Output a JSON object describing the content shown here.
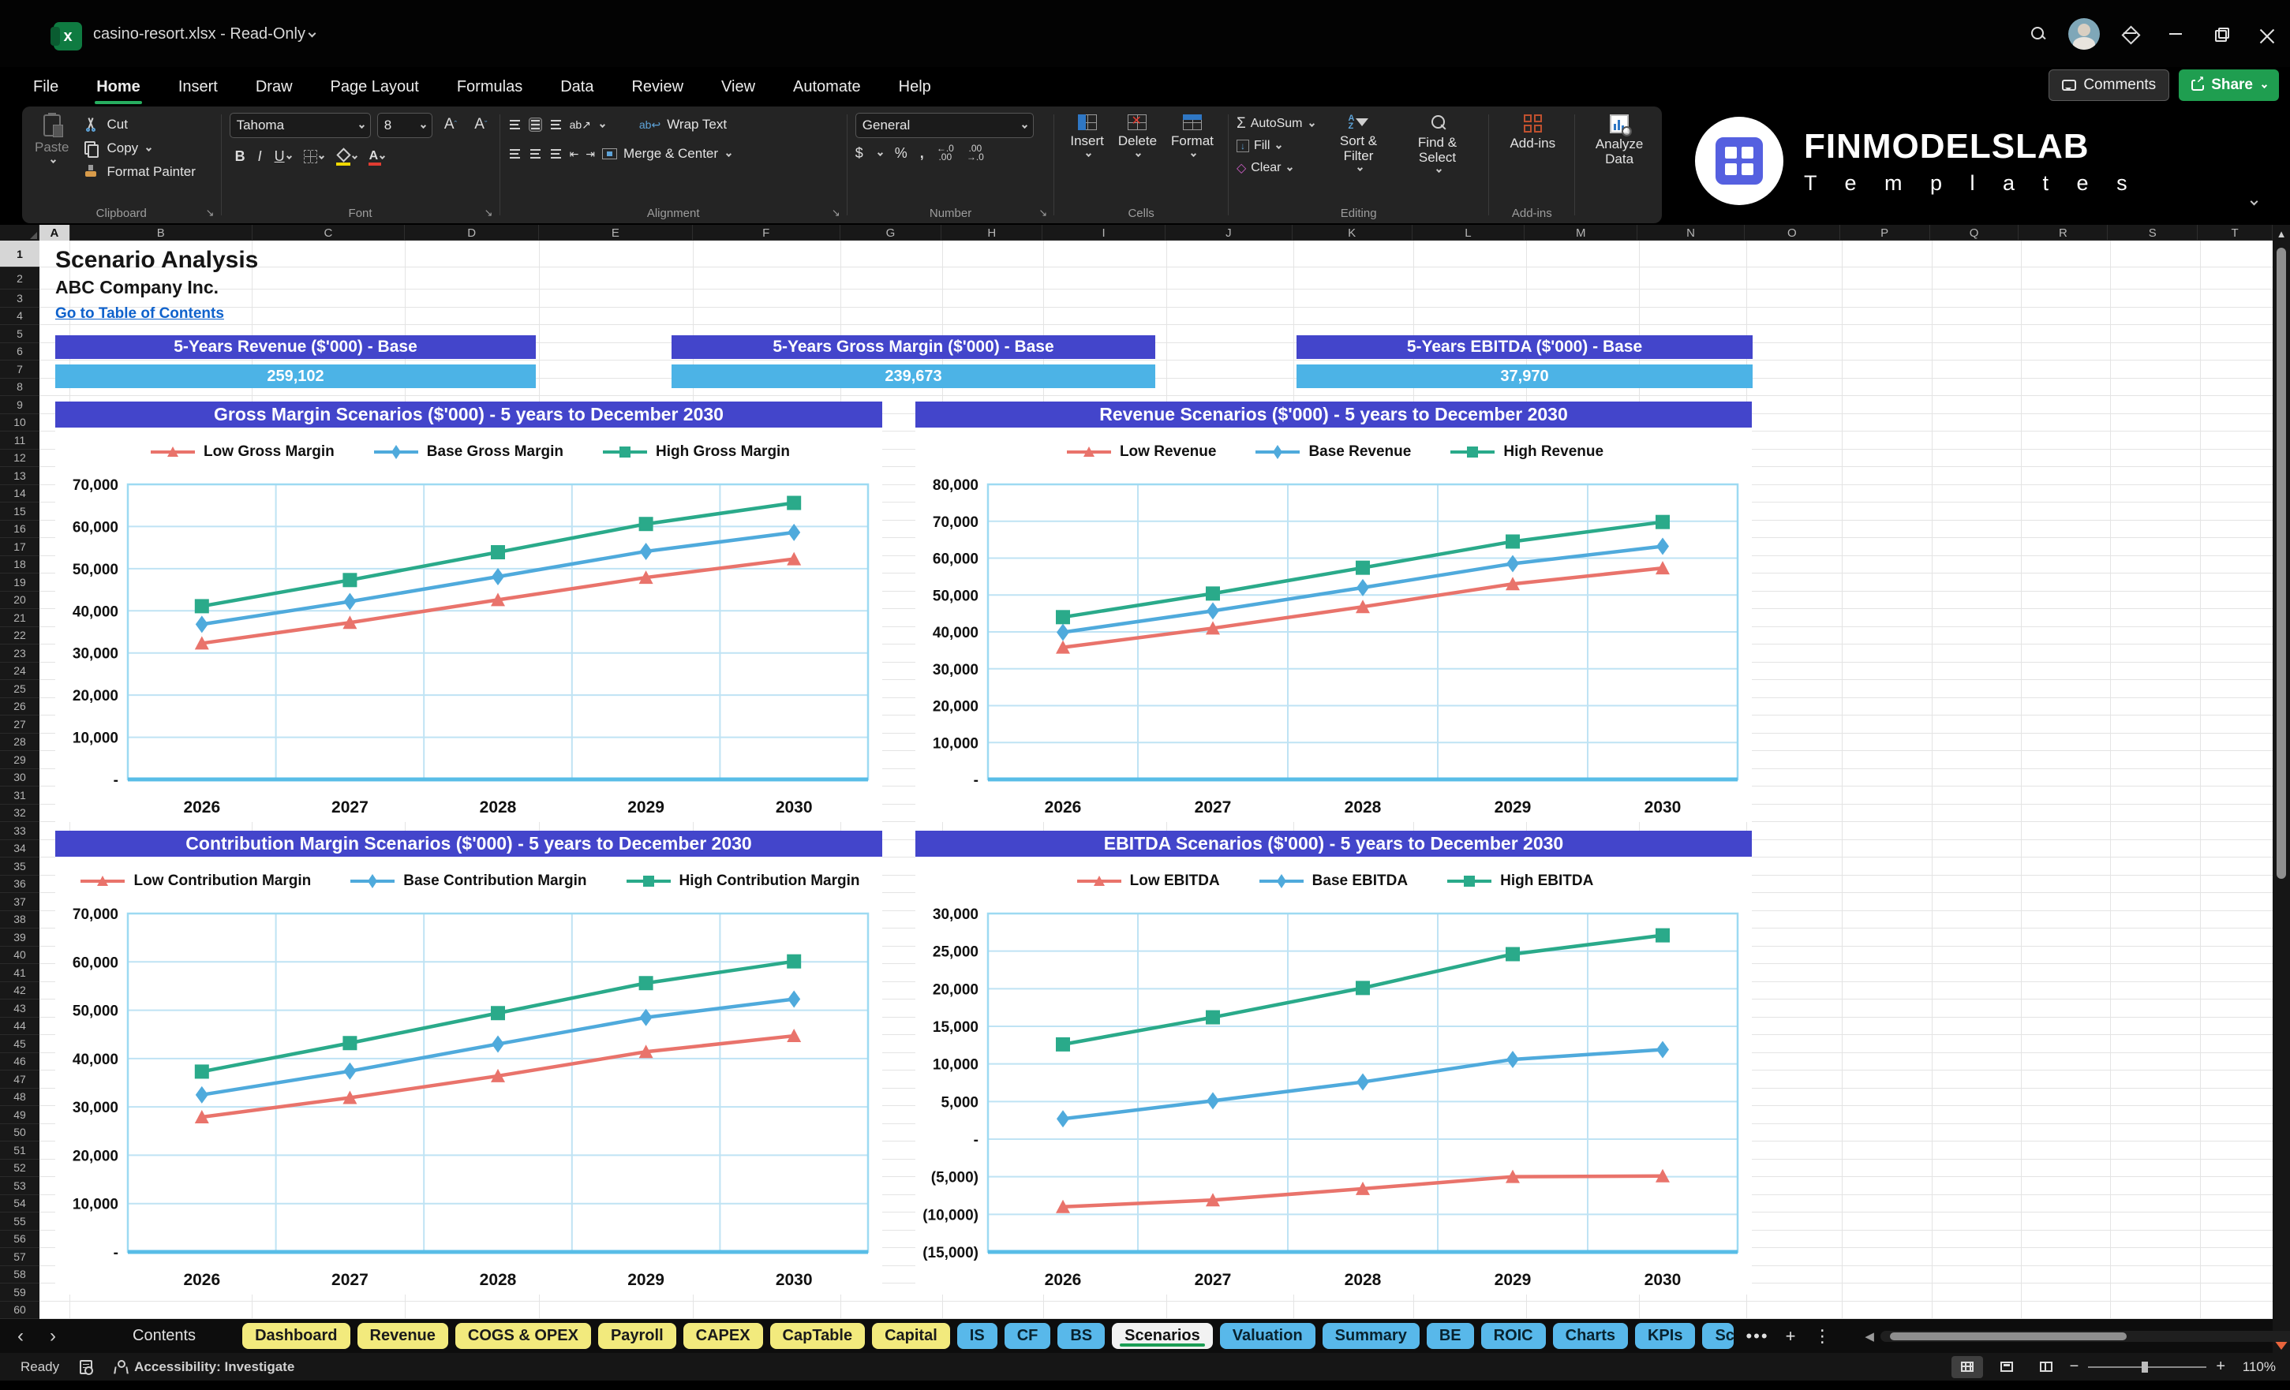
{
  "titlebar": {
    "file_label": "casino-resort.xlsx  -  Read-Only",
    "comments_label": "Comments",
    "share_label": "Share"
  },
  "menu": {
    "items": [
      "File",
      "Home",
      "Insert",
      "Draw",
      "Page Layout",
      "Formulas",
      "Data",
      "Review",
      "View",
      "Automate",
      "Help"
    ],
    "active_item": "Home"
  },
  "ribbon": {
    "clipboard": {
      "label": "Clipboard",
      "paste": "Paste",
      "cut": "Cut",
      "copy": "Copy",
      "format_painter": "Format Painter"
    },
    "font": {
      "label": "Font",
      "family": "Tahoma",
      "size": "8"
    },
    "alignment": {
      "label": "Alignment",
      "wrap_text": "Wrap Text",
      "merge_center": "Merge & Center"
    },
    "number": {
      "label": "Number",
      "format": "General"
    },
    "cells": {
      "label": "Cells",
      "insert": "Insert",
      "delete": "Delete",
      "format": "Format"
    },
    "editing": {
      "label": "Editing",
      "autosum": "AutoSum",
      "fill": "Fill",
      "clear": "Clear",
      "sort_filter": "Sort & Filter",
      "find_select": "Find & Select"
    },
    "addins": {
      "label": "Add-ins",
      "addins": "Add-ins",
      "analyze_data": "Analyze Data"
    },
    "logo_line1": "FINMODELSLAB",
    "logo_line2": "T e m p l a t e s"
  },
  "sheet": {
    "columns": [
      "A",
      "B",
      "C",
      "D",
      "E",
      "F",
      "G",
      "H",
      "I",
      "J",
      "K",
      "L",
      "M",
      "N",
      "O",
      "P",
      "Q",
      "R",
      "S",
      "T"
    ],
    "rows": [
      1,
      2,
      3,
      4,
      5,
      6,
      7,
      8,
      9,
      10,
      11,
      12,
      13,
      14,
      15,
      16,
      17,
      18,
      19,
      20,
      21,
      22,
      23,
      24,
      25,
      26,
      27,
      28,
      29,
      30,
      31,
      32,
      33,
      34,
      35,
      36,
      37,
      38,
      39,
      40,
      41,
      42,
      43,
      44,
      45,
      46,
      47,
      48,
      49,
      50,
      51,
      52,
      53,
      54,
      55,
      56,
      57,
      58,
      59,
      60
    ],
    "title": "Scenario Analysis",
    "company": "ABC Company Inc.",
    "link": "Go to Table of Contents",
    "kpis": [
      {
        "label": "5-Years Revenue ($'000) - Base",
        "value": "259,102"
      },
      {
        "label": "5-Years Gross Margin ($'000) - Base",
        "value": "239,673"
      },
      {
        "label": "5-Years EBITDA ($'000) - Base",
        "value": "37,970"
      }
    ]
  },
  "chart_data": [
    {
      "type": "line",
      "title": "Gross Margin Scenarios ($'000) - 5 years to December 2030",
      "categories": [
        "2026",
        "2027",
        "2028",
        "2029",
        "2030"
      ],
      "ylim": [
        0,
        70000
      ],
      "ytick_step": 10000,
      "grid": true,
      "legend_position": "top",
      "series": [
        {
          "name": "Low Gross Margin",
          "color": "#e9736b",
          "marker": "triangle",
          "values": [
            32300,
            37200,
            42600,
            47900,
            52300
          ]
        },
        {
          "name": "Base Gross Margin",
          "color": "#4faadc",
          "marker": "diamond",
          "values": [
            36800,
            42200,
            48100,
            54100,
            58600
          ]
        },
        {
          "name": "High Gross Margin",
          "color": "#2aaa8a",
          "marker": "square",
          "values": [
            41100,
            47300,
            53900,
            60600,
            65600
          ]
        }
      ]
    },
    {
      "type": "line",
      "title": "Revenue Scenarios ($'000) - 5 years to December 2030",
      "categories": [
        "2026",
        "2027",
        "2028",
        "2029",
        "2030"
      ],
      "ylim": [
        0,
        80000
      ],
      "ytick_step": 10000,
      "grid": true,
      "legend_position": "top",
      "series": [
        {
          "name": "Low Revenue",
          "color": "#e9736b",
          "marker": "triangle",
          "values": [
            35800,
            41000,
            46800,
            53000,
            57300
          ]
        },
        {
          "name": "Base Revenue",
          "color": "#4faadc",
          "marker": "diamond",
          "values": [
            39900,
            45700,
            52000,
            58500,
            63200
          ]
        },
        {
          "name": "High Revenue",
          "color": "#2aaa8a",
          "marker": "square",
          "values": [
            44000,
            50400,
            57400,
            64500,
            69800
          ]
        }
      ]
    },
    {
      "type": "line",
      "title": "Contribution Margin Scenarios ($'000) - 5 years to December 2030",
      "categories": [
        "2026",
        "2027",
        "2028",
        "2029",
        "2030"
      ],
      "ylim": [
        0,
        70000
      ],
      "ytick_step": 10000,
      "grid": true,
      "legend_position": "top",
      "series": [
        {
          "name": "Low Contribution Margin",
          "color": "#e9736b",
          "marker": "triangle",
          "values": [
            27900,
            31900,
            36400,
            41400,
            44700
          ]
        },
        {
          "name": "Base Contribution Margin",
          "color": "#4faadc",
          "marker": "diamond",
          "values": [
            32500,
            37400,
            43000,
            48500,
            52300
          ]
        },
        {
          "name": "High Contribution Margin",
          "color": "#2aaa8a",
          "marker": "square",
          "values": [
            37300,
            43200,
            49400,
            55600,
            60100
          ]
        }
      ]
    },
    {
      "type": "line",
      "title": "EBITDA Scenarios ($'000) - 5 years to December 2030",
      "categories": [
        "2026",
        "2027",
        "2028",
        "2029",
        "2030"
      ],
      "ylim": [
        -15000,
        30000
      ],
      "ytick_step": 5000,
      "grid": true,
      "legend_position": "top",
      "series": [
        {
          "name": "Low EBITDA",
          "color": "#e9736b",
          "marker": "triangle",
          "values": [
            -9000,
            -8100,
            -6600,
            -5000,
            -4900
          ]
        },
        {
          "name": "Base EBITDA",
          "color": "#4faadc",
          "marker": "diamond",
          "values": [
            2700,
            5100,
            7600,
            10600,
            11900
          ]
        },
        {
          "name": "High EBITDA",
          "color": "#2aaa8a",
          "marker": "square",
          "values": [
            12600,
            16200,
            20100,
            24600,
            27100
          ]
        }
      ]
    }
  ],
  "tabs": {
    "contents": "Contents",
    "yellow": [
      "Dashboard",
      "Revenue",
      "COGS & OPEX",
      "Payroll",
      "CAPEX",
      "CapTable",
      "Capital"
    ],
    "blue_before": [
      "IS",
      "CF",
      "BS"
    ],
    "active": "Scenarios",
    "blue_after": [
      "Valuation",
      "Summary",
      "BE",
      "ROIC",
      "Charts",
      "KPIs",
      "Sc"
    ]
  },
  "statusbar": {
    "ready": "Ready",
    "accessibility": "Accessibility: Investigate",
    "zoom_level": "110%"
  },
  "colors": {
    "accent_green": "#1f9e50",
    "banner_purple": "#4345cb",
    "kpi_blue": "#4cb3e6",
    "series_low": "#e9736b",
    "series_base": "#4faadc",
    "series_high": "#2aaa8a",
    "tab_yellow": "#f2ea7d",
    "tab_blue": "#58b8ea",
    "scroll_accent_orange": "#e8643c"
  }
}
